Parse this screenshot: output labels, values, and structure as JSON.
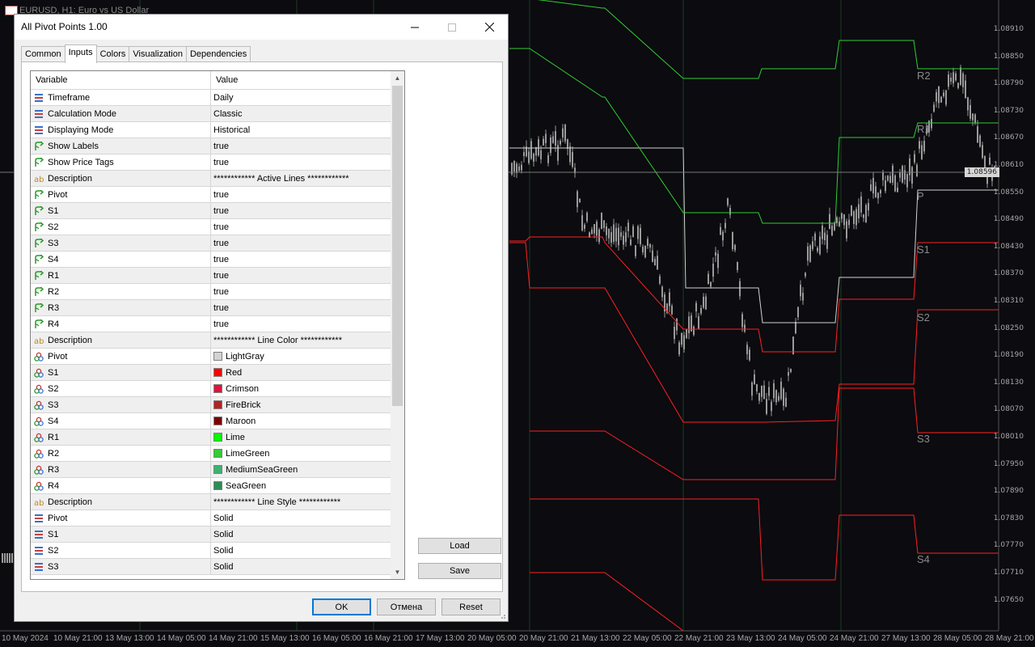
{
  "chart": {
    "title": "EURUSD, H1:  Euro vs US Dollar",
    "price_labels": [
      "1.08910",
      "1.08850",
      "1.08790",
      "1.08730",
      "1.08670",
      "1.08610",
      "1.08550",
      "1.08490",
      "1.08430",
      "1.08370",
      "1.08310",
      "1.08250",
      "1.08190",
      "1.08130",
      "1.08070",
      "1.08010",
      "1.07950",
      "1.07890",
      "1.07830",
      "1.07770",
      "1.07710",
      "1.07650"
    ],
    "current_price": "1.08596",
    "time_labels": [
      "10 May 2024",
      "10 May 21:00",
      "13 May 13:00",
      "14 May 05:00",
      "14 May 21:00",
      "15 May 13:00",
      "16 May 05:00",
      "16 May 21:00",
      "17 May 13:00",
      "20 May 05:00",
      "20 May 21:00",
      "21 May 13:00",
      "22 May 05:00",
      "22 May 21:00",
      "23 May 13:00",
      "24 May 05:00",
      "24 May 21:00",
      "27 May 13:00",
      "28 May 05:00",
      "28 May 21:00"
    ],
    "pivot_tags": [
      "R2",
      "R1",
      "P",
      "S1",
      "S2",
      "S3",
      "S4"
    ],
    "colors": {
      "pivot": "#d3d3d3",
      "support": "#ff2020",
      "resistance": "#32cd32",
      "candle": "#9a9a9a",
      "background": "#0b0b10"
    }
  },
  "dialog": {
    "title": "All Pivot Points 1.00",
    "tabs": [
      "Common",
      "Inputs",
      "Colors",
      "Visualization",
      "Dependencies"
    ],
    "active_tab": "Inputs",
    "columns": {
      "variable": "Variable",
      "value": "Value"
    },
    "rows": [
      {
        "icon": "enum-icon",
        "name": "Timeframe",
        "value": "Daily"
      },
      {
        "icon": "enum-icon",
        "name": "Calculation Mode",
        "value": "Classic"
      },
      {
        "icon": "enum-icon",
        "name": "Displaying Mode",
        "value": "Historical"
      },
      {
        "icon": "bool-icon",
        "name": "Show Labels",
        "value": "true"
      },
      {
        "icon": "bool-icon",
        "name": "Show Price Tags",
        "value": "true"
      },
      {
        "icon": "string-icon",
        "name": "Description",
        "value": "************ Active Lines ************"
      },
      {
        "icon": "bool-icon",
        "name": "Pivot",
        "value": "true"
      },
      {
        "icon": "bool-icon",
        "name": "S1",
        "value": "true"
      },
      {
        "icon": "bool-icon",
        "name": "S2",
        "value": "true"
      },
      {
        "icon": "bool-icon",
        "name": "S3",
        "value": "true"
      },
      {
        "icon": "bool-icon",
        "name": "S4",
        "value": "true"
      },
      {
        "icon": "bool-icon",
        "name": "R1",
        "value": "true"
      },
      {
        "icon": "bool-icon",
        "name": "R2",
        "value": "true"
      },
      {
        "icon": "bool-icon",
        "name": "R3",
        "value": "true"
      },
      {
        "icon": "bool-icon",
        "name": "R4",
        "value": "true"
      },
      {
        "icon": "string-icon",
        "name": "Description",
        "value": "************ Line Color ************"
      },
      {
        "icon": "color-icon",
        "name": "Pivot",
        "value": "LightGray",
        "color": "#d3d3d3"
      },
      {
        "icon": "color-icon",
        "name": "S1",
        "value": "Red",
        "color": "#ff0000"
      },
      {
        "icon": "color-icon",
        "name": "S2",
        "value": "Crimson",
        "color": "#dc143c"
      },
      {
        "icon": "color-icon",
        "name": "S3",
        "value": "FireBrick",
        "color": "#b22222"
      },
      {
        "icon": "color-icon",
        "name": "S4",
        "value": "Maroon",
        "color": "#800000"
      },
      {
        "icon": "color-icon",
        "name": "R1",
        "value": "Lime",
        "color": "#00ff00"
      },
      {
        "icon": "color-icon",
        "name": "R2",
        "value": "LimeGreen",
        "color": "#32cd32"
      },
      {
        "icon": "color-icon",
        "name": "R3",
        "value": "MediumSeaGreen",
        "color": "#3cb371"
      },
      {
        "icon": "color-icon",
        "name": "R4",
        "value": "SeaGreen",
        "color": "#2e8b57"
      },
      {
        "icon": "string-icon",
        "name": "Description",
        "value": "************ Line Style ************"
      },
      {
        "icon": "enum-icon",
        "name": "Pivot",
        "value": "Solid"
      },
      {
        "icon": "enum-icon",
        "name": "S1",
        "value": "Solid"
      },
      {
        "icon": "enum-icon",
        "name": "S2",
        "value": "Solid"
      },
      {
        "icon": "enum-icon",
        "name": "S3",
        "value": "Solid"
      }
    ],
    "buttons": {
      "load": "Load",
      "save": "Save",
      "ok": "OK",
      "cancel": "Отмена",
      "reset": "Reset"
    }
  }
}
